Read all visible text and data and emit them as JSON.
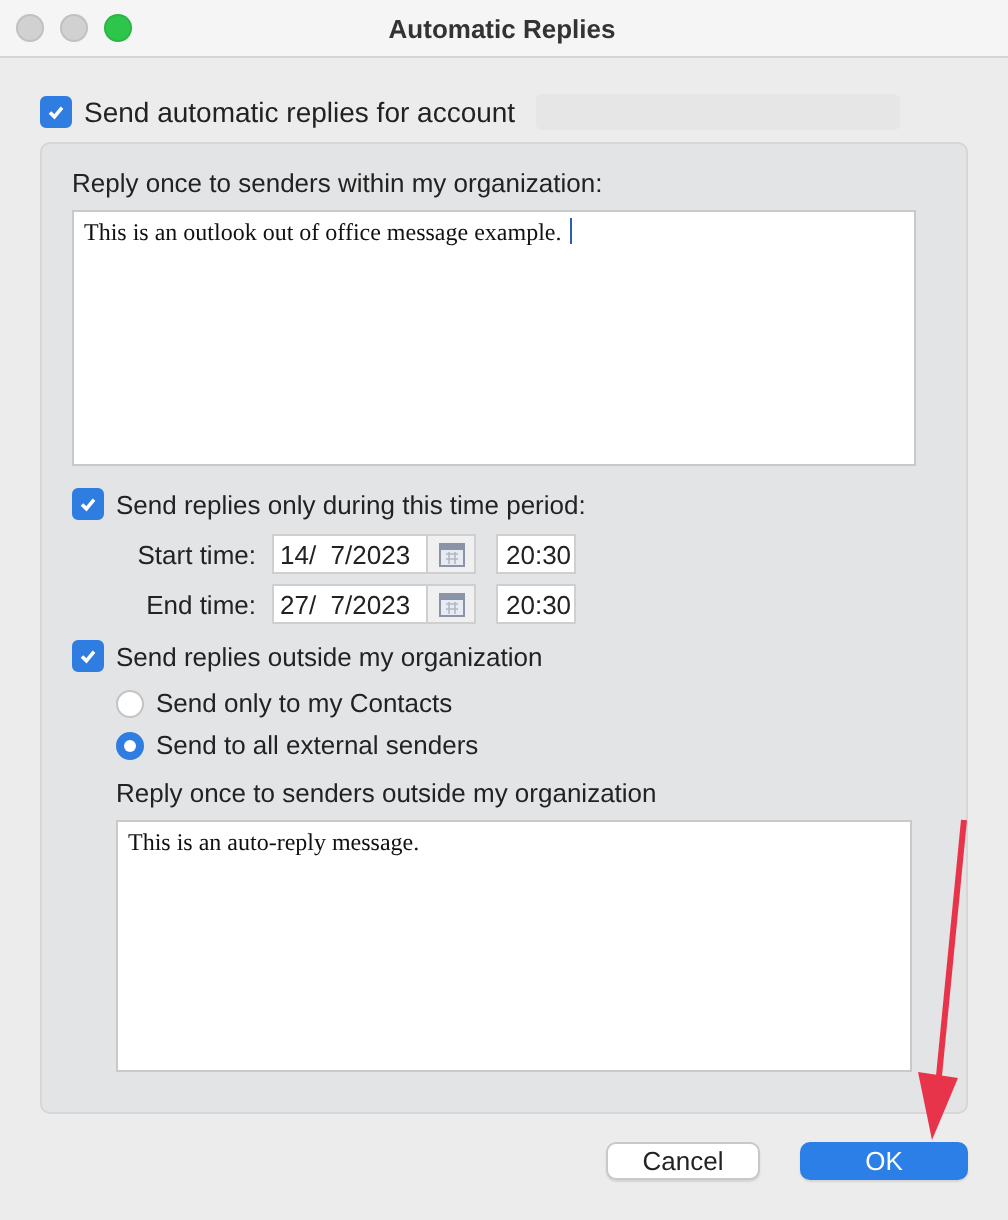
{
  "window": {
    "title": "Automatic Replies"
  },
  "send_automatic": {
    "label": "Send automatic replies for account",
    "checked": true,
    "account_redacted": true
  },
  "inside": {
    "label": "Reply once to senders within my organization:",
    "message": "This is an outlook out of office message example.",
    "caret": true
  },
  "time_period": {
    "label": "Send replies only during this time period:",
    "checked": true,
    "rows": [
      {
        "label": "Start time:",
        "date": "14/  7/2023",
        "time": "20:30"
      },
      {
        "label": "End time:",
        "date": "27/  7/2023",
        "time": "20:30"
      }
    ]
  },
  "outside": {
    "label": "Send replies outside my organization",
    "checked": true,
    "options": [
      {
        "label": "Send only to my Contacts",
        "selected": false
      },
      {
        "label": "Send to all external senders",
        "selected": true
      }
    ],
    "message_label": "Reply once to senders outside my organization",
    "message": "This is an auto-reply message."
  },
  "buttons": [
    {
      "label": "Cancel",
      "kind": "secondary"
    },
    {
      "label": "OK",
      "kind": "primary"
    }
  ],
  "annotation": {
    "kind": "arrow"
  }
}
